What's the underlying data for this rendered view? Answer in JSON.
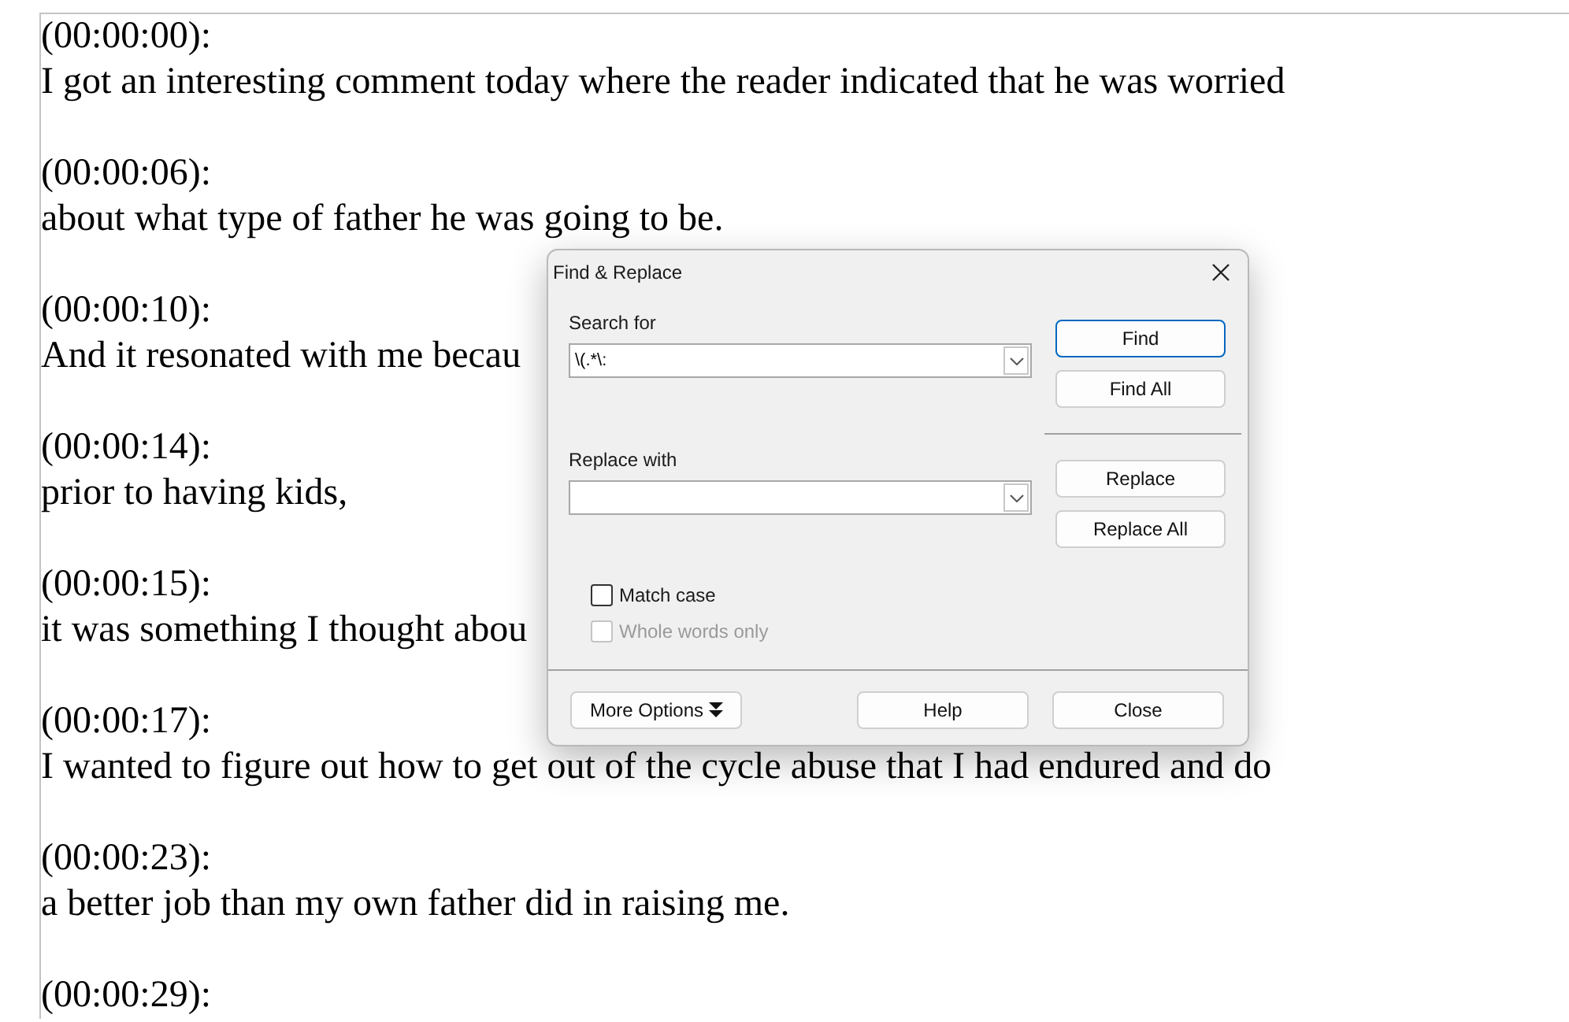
{
  "document": {
    "entries": [
      {
        "timestamp": "(00:00:00):",
        "text": "I got an interesting comment today where the reader indicated that he was worried"
      },
      {
        "timestamp": "(00:00:06):",
        "text": "about what type of father he was going to be."
      },
      {
        "timestamp": "(00:00:10):",
        "text": "And it resonated with me becau"
      },
      {
        "timestamp": "(00:00:14):",
        "text": "prior to having kids,"
      },
      {
        "timestamp": "(00:00:15):",
        "text": "it was something I thought abou"
      },
      {
        "timestamp": "(00:00:17):",
        "text": "I wanted to figure out how to get out of the cycle abuse that I had endured and do"
      },
      {
        "timestamp": "(00:00:23):",
        "text": "a better job than my own father did in raising me."
      },
      {
        "timestamp": "(00:00:29):"
      }
    ]
  },
  "dialog": {
    "title": "Find & Replace",
    "search": {
      "label": "Search for",
      "value": "\\(.*\\:"
    },
    "replace": {
      "label": "Replace with"
    },
    "side_buttons": [
      {
        "label": "Find",
        "kind": "default"
      },
      {
        "label": "Find All",
        "kind": "normal"
      },
      {
        "label": "Replace",
        "kind": "normal"
      },
      {
        "label": "Replace All",
        "kind": "normal"
      }
    ],
    "options": [
      {
        "label": "Match case",
        "checked": false,
        "disabled": false
      },
      {
        "label": "Whole words only",
        "checked": false,
        "disabled": true
      }
    ],
    "more_options": {
      "label": "More Options"
    },
    "footer_buttons": [
      {
        "label": "Help"
      },
      {
        "label": "Close"
      }
    ]
  }
}
